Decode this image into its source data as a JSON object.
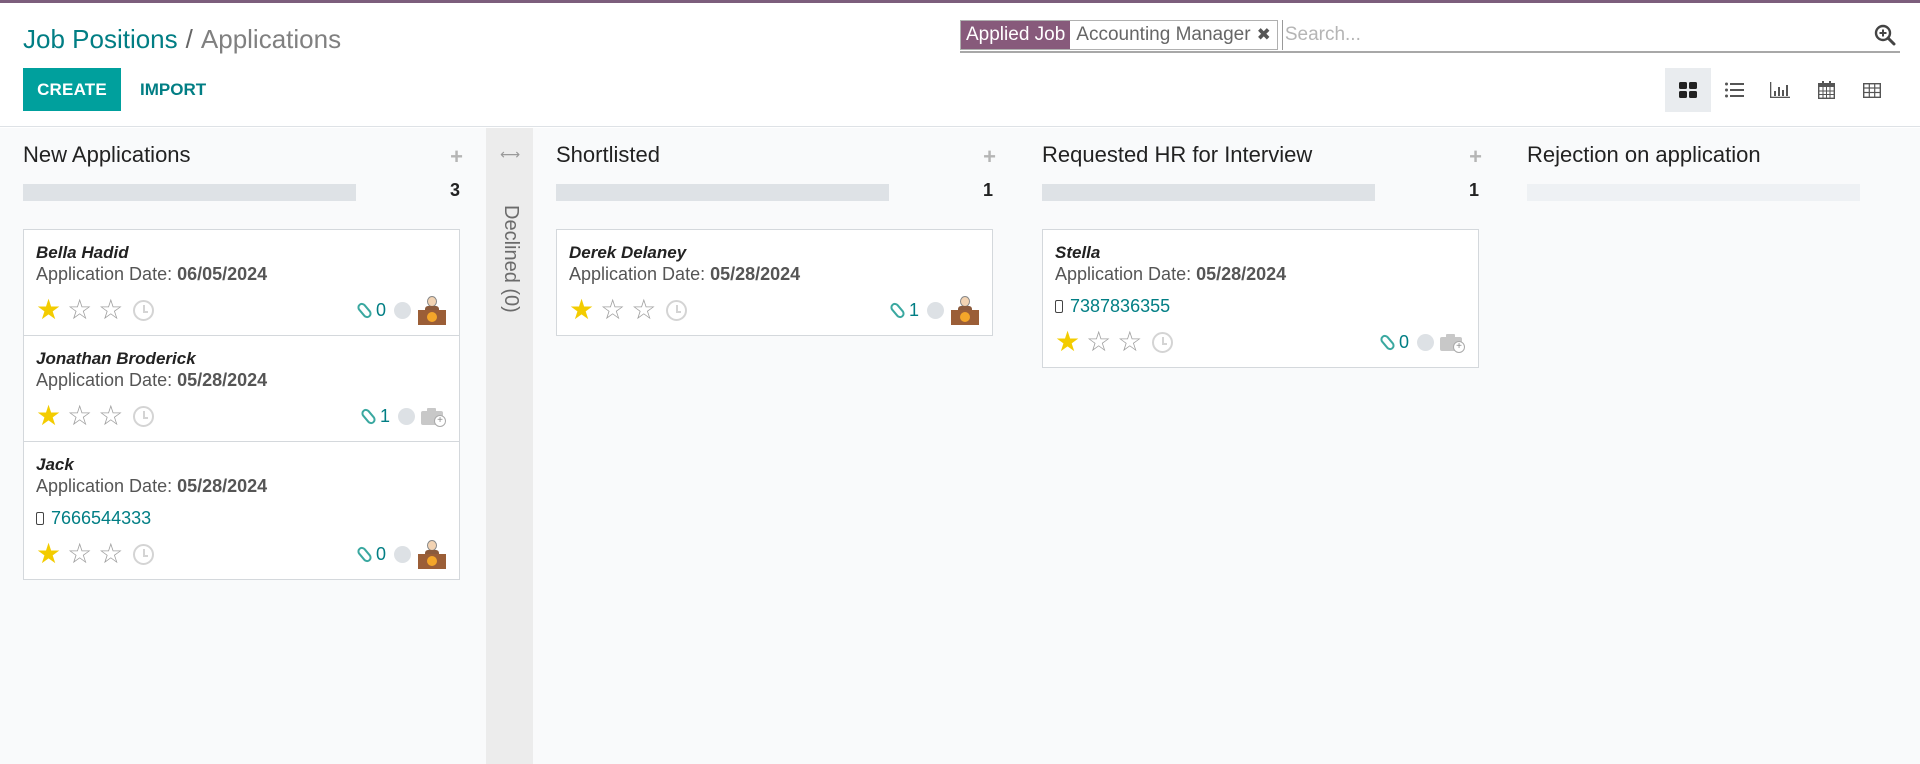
{
  "header": {
    "breadcrumb": [
      {
        "label": "Job Positions"
      },
      {
        "label": "Applications"
      }
    ],
    "separator": "/",
    "create_label": "CREATE",
    "import_label": "IMPORT"
  },
  "search": {
    "facets": [
      {
        "label": "Applied Job",
        "value": "Accounting Manager",
        "remove_icon": "×"
      }
    ],
    "placeholder": "Search...",
    "search_icon": "search-plus-icon"
  },
  "views": [
    {
      "name": "kanban",
      "icon": "kanban-icon",
      "active": true
    },
    {
      "name": "list",
      "icon": "list-icon",
      "active": false
    },
    {
      "name": "graph",
      "icon": "bar-chart-icon",
      "active": false
    },
    {
      "name": "calendar",
      "icon": "calendar-icon",
      "active": false
    },
    {
      "name": "pivot",
      "icon": "pivot-table-icon",
      "active": false
    }
  ],
  "columns": [
    {
      "title": "New Applications",
      "count": "3",
      "add_icon": "+",
      "cards": [
        {
          "name": "Bella Hadid",
          "date_label": "Application Date:",
          "date": "06/05/2024",
          "phone": null,
          "stars": 1,
          "attachments": "0",
          "avatar": "person"
        },
        {
          "name": "Jonathan Broderick",
          "date_label": "Application Date:",
          "date": "05/28/2024",
          "phone": null,
          "stars": 1,
          "attachments": "1",
          "avatar": "camera"
        },
        {
          "name": "Jack",
          "date_label": "Application Date:",
          "date": "05/28/2024",
          "phone": "7666544333",
          "stars": 1,
          "attachments": "0",
          "avatar": "person"
        }
      ]
    },
    {
      "title": "Shortlisted",
      "count": "1",
      "add_icon": "+",
      "cards": [
        {
          "name": "Derek Delaney",
          "date_label": "Application Date:",
          "date": "05/28/2024",
          "phone": null,
          "stars": 1,
          "attachments": "1",
          "avatar": "person"
        }
      ]
    },
    {
      "title": "Requested HR for Interview",
      "count": "1",
      "add_icon": "+",
      "cards": [
        {
          "name": "Stella",
          "date_label": "Application Date:",
          "date": "05/28/2024",
          "phone": "7387836355",
          "stars": 1,
          "attachments": "0",
          "avatar": "camera"
        }
      ]
    },
    {
      "title": "Rejection on application",
      "count": "",
      "add_icon": "",
      "cards": []
    }
  ],
  "folded_column": {
    "label": "Declined (0)",
    "arrow": "⟷"
  },
  "colors": {
    "brand_purple": "#875a7b",
    "primary_teal": "#00a09d",
    "link_teal": "#017e84",
    "star_yellow": "#f3cc00"
  }
}
